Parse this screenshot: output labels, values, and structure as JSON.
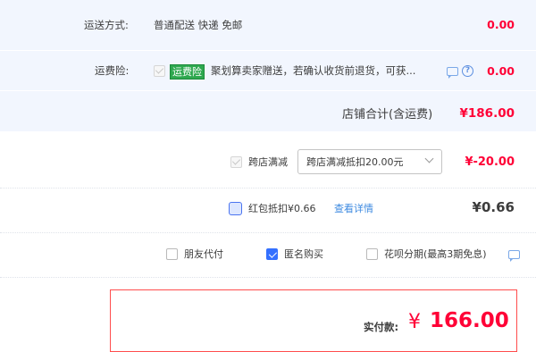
{
  "shipping": {
    "label": "运送方式:",
    "method": "普通配送 快递 免邮",
    "price": "0.00"
  },
  "insurance": {
    "label": "运费险:",
    "badge": "运费险",
    "desc": "聚划算卖家赠送，若确认收货前退货，可获...",
    "price": "0.00"
  },
  "store_total": {
    "label": "店铺合计(含运费)",
    "amount": "¥186.00"
  },
  "cross_store": {
    "label": "跨店满减",
    "select_value": "跨店满减抵扣20.00元",
    "amount": "¥-20.00"
  },
  "red_packet": {
    "label": "红包抵扣¥0.66",
    "link": "查看详情",
    "amount": "¥0.66"
  },
  "options": [
    {
      "label": "朋友代付",
      "checked": false
    },
    {
      "label": "匿名购买",
      "checked": true
    },
    {
      "label": "花呗分期(最高3期免息)",
      "checked": false
    }
  ],
  "payment": {
    "label": "实付款:",
    "currency": "¥",
    "amount": "166.00"
  },
  "colors": {
    "accent_red": "#ff0036",
    "panel_blue": "#f2f6fe",
    "checkbox_blue": "#3470ff",
    "badge_green": "#2ea84f"
  }
}
